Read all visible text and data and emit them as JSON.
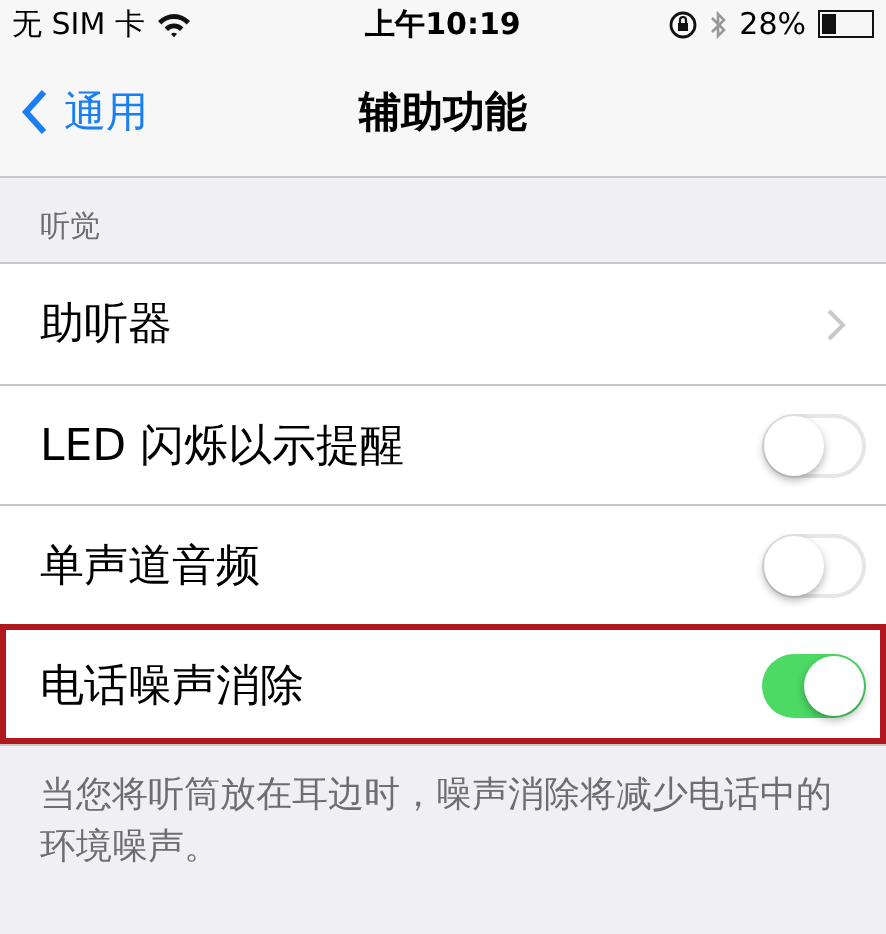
{
  "status_bar": {
    "carrier": "无 SIM 卡",
    "time": "上午10:19",
    "battery_text": "28%"
  },
  "nav": {
    "back": "通用",
    "title": "辅助功能"
  },
  "section": {
    "header": "听觉",
    "rows": [
      {
        "label": "助听器",
        "kind": "link",
        "highlighted": false
      },
      {
        "label": "LED 闪烁以示提醒",
        "kind": "switch",
        "on": false,
        "highlighted": false
      },
      {
        "label": "单声道音频",
        "kind": "switch",
        "on": false,
        "highlighted": false
      },
      {
        "label": "电话噪声消除",
        "kind": "switch",
        "on": true,
        "highlighted": true
      }
    ],
    "footer": "当您将听筒放在耳边时，噪声消除将减少电话中的环境噪声。"
  }
}
